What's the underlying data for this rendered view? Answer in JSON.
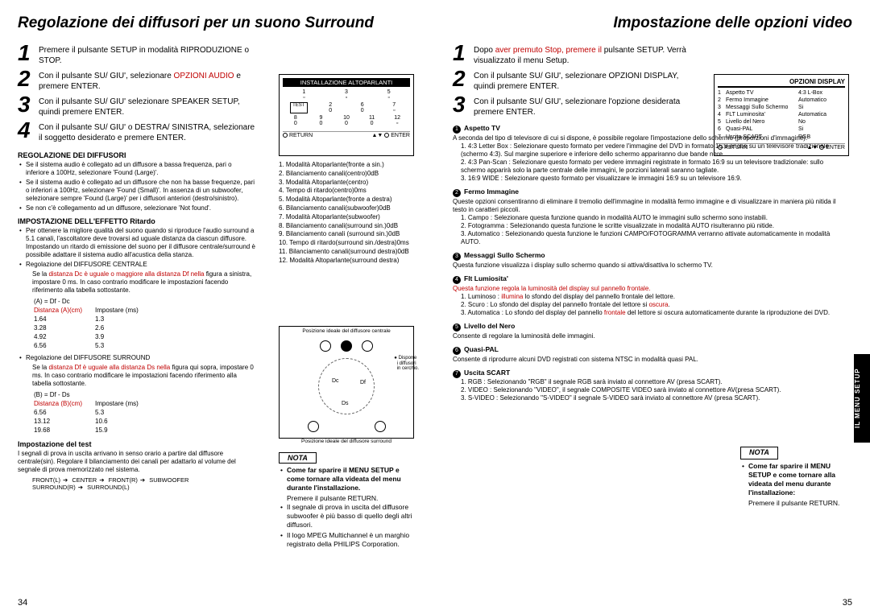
{
  "left": {
    "title": "Regolazione dei diffusori per un suono Surround",
    "steps": [
      {
        "n": "1",
        "txt": "Premere il pulsante SETUP in modalità RIPRODUZIONE o STOP."
      },
      {
        "n": "2",
        "txt_a": "Con il pulsante SU/ GIU', selezionare ",
        "red": "OPZIONI AUDIO",
        "txt_b": " e premere ENTER."
      },
      {
        "n": "3",
        "txt": "Con il pulsante SU/ GIU' selezionare SPEAKER SETUP, quindi premere ENTER."
      },
      {
        "n": "4",
        "txt": "Con il pulsante SU/ GIU' o DESTRA/ SINISTRA, selezionare il soggetto desiderato e premere ENTER."
      }
    ],
    "reg_h": "REGOLAZIONE DEI DIFFUSORI",
    "reg_b": [
      "Se il sistema audio è collegato ad un diffusore a bassa frequenza, pari o inferiore a 100Hz, selezionare 'Found (Large)'.",
      "Se il sistema audio è collegato ad un diffusore che non ha basse frequenze, pari o inferiori a 100Hz, selezionare 'Found (Small)'. In assenza di un subwoofer, selezionare sempre 'Found (Large)' per i diffusori anteriori (destro/sinistro).",
      "Se non c'è collegamento ad un diffusore, selezionare 'Not found'."
    ],
    "eff_h": "IMPOSTAZIONE DELL'EFFETTO Ritardo",
    "eff_b": "Per ottenere la migliore qualità del suono quando si riproduce l'audio surround a 5.1 canali, l'ascoltatore deve trovarsi ad uguale distanza da ciascun diffusore. Impostando un ritardo di emissione del suono per il diffusore centrale/surround è possibile adattare il sistema audio all'acustica della stanza.",
    "cen_h": "Regolazione del DIFFUSORE CENTRALE",
    "cen_red": "distanza Dc è uguale o maggiore alla distanza Df nella",
    "cen_txt": "Se la [RED] figura a sinistra, impostare 0 ms. In caso contrario modificare le impostazioni facendo riferimento alla tabella sottostante.",
    "tabA_h": "(A) = Df - Dc",
    "tabA_c1": "Distanza (A)(cm)",
    "tabA_c2": "Impostare (ms)",
    "tabA": [
      [
        "1.64",
        "1.3"
      ],
      [
        "3.28",
        "2.6"
      ],
      [
        "4.92",
        "3.9"
      ],
      [
        "6.56",
        "5.3"
      ]
    ],
    "sur_h": "Regolazione del DIFFUSORE SURROUND",
    "sur_red": "distanza Df è uguale alla distanza Ds nella",
    "sur_txt": "Se la [RED] figura qui sopra, impostare 0 ms. In caso contrario modificare le impostazioni facendo riferimento alla tabella sottostante.",
    "tabB_h": "(B) = Df - Ds",
    "tabB_c1": "Distanza (B)(cm)",
    "tabB_c2": "Impostare (ms)",
    "tabB": [
      [
        "6.56",
        "5.3"
      ],
      [
        "13.12",
        "10.6"
      ],
      [
        "19.68",
        "15.9"
      ]
    ],
    "test_h": "Impostazione del test",
    "test_b": "I segnali di prova in uscita arrivano in senso orario a partire dal diffusore centrale(sin). Regolare il bilanciamento dei canali per adattarlo al volume del segnale di prova memorizzato nel sistema.",
    "chain": [
      "FRONT(L)",
      "CENTER",
      "FRONT(R)",
      "SUBWOOFER",
      "SURROUND(R)",
      "SURROUND(L)"
    ],
    "panel_h": "INSTALLAZIONE ALTOPARLANTI",
    "panel_ret": "RETURN",
    "panel_ent": "ENTER",
    "panel_test": "TEST",
    "modes": [
      "1. Modalità Altoparlante(fronte a sin.)",
      "2. Bilanciamento canali(centro)0dB",
      "3. Modalità Altoparlante(centro)",
      "4. Tempo di ritardo(centro)0ms",
      "5. Modalità Altoparlante(fronte a destra)",
      "6. Bilanciamento canali(subwoofer)0dB",
      "7. Modalità Altoparlante(subwoofer)",
      "8. Bilanciamento canali(surround sin.)0dB",
      "9. Bilanciamento canali (surround sin.)0dB",
      "10. Tempo di ritardo(surround sin./destra)0ms",
      "11. Bilanciamento canali(surround destra)0dB",
      "12. Modalità Altoparlante(surround destra)"
    ],
    "diag_top": "Posizione ideale del diffusore centrale",
    "diag_bot": "Posizione ideale del diffusore surround",
    "diag_leg1": "Disporre",
    "diag_leg2": "i diffusori",
    "diag_leg3": "in cerchio.",
    "nota": "NOTA",
    "note1": "Come far sparire il MENU SETUP e come tornare alla videata del menu durante l'installazione.",
    "note2": "Premere il pulsante RETURN.",
    "note3": "Il segnale di prova in uscita del diffusore subwoofer è più basso di quello degli altri diffusori.",
    "note4": "Il logo MPEG Multichannel è un marghio registrato della PHILIPS Corporation.",
    "pageno": "34"
  },
  "right": {
    "title": "Impostazione delle opzioni video",
    "steps": [
      {
        "n": "1",
        "txt_a": "Dopo ",
        "red": "aver premuto Stop, premere il",
        "txt_b": " pulsante SETUP. Verrà visualizzato il menu Setup."
      },
      {
        "n": "2",
        "txt": "Con il pulsante SU/ GIU', selezionare OPZIONI DISPLAY, quindi premere ENTER."
      },
      {
        "n": "3",
        "txt": "Con il pulsante SU/ GIU', selezionare l'opzione desiderata premere ENTER."
      }
    ],
    "panel_h": "OPZIONI DISPLAY",
    "panel_items": [
      [
        "1",
        "Aspetto TV",
        "4:3 L-Box"
      ],
      [
        "2",
        "Fermo Immagine",
        "Automatico"
      ],
      [
        "3",
        "Messaggi Sullo Schermo",
        "Si"
      ],
      [
        "4",
        "FLT Luminosita'",
        "Automatica"
      ],
      [
        "5",
        "Livello del Nero",
        "No"
      ],
      [
        "6",
        "Quasi-PAL",
        "Si"
      ],
      [
        "7",
        "Uscita SCART",
        "RGB"
      ]
    ],
    "panel_ret": "RETURN",
    "panel_ent": "ENTER",
    "items": [
      {
        "n": "1",
        "h": "Aspetto TV",
        "d": "A seconda del tipo di televisore di cui si dispone, è possibile regolare l'impostazione dello schermo (proporzioni d'immagine).",
        "sub": [
          "1. 4:3 Letter Box : Selezionare questo formato per vedere l'immagine del DVD in formato 16:9 anche su un televisore tradizionale (schermo 4:3). Sul margine superiore e inferiore dello schermo appariranno due bande nere.",
          "2. 4:3 Pan-Scan : Selezionare questo formato per  vedere immagini registrate in formato 16:9 su un televisore tradizionale: sullo schermo apparirà solo la parte centrale delle immagini, le porzioni laterali saranno tagliate.",
          "3. 16:9 WIDE : Selezionare questo formato per visualizzare le immagini 16:9 su un televisore 16:9."
        ]
      },
      {
        "n": "2",
        "h": "Fermo Immagine",
        "d": "Queste opzioni consentiranno di eliminare il tremolio dell'immagine in modalità fermo immagine e di visualizzare in maniera più nitida il testo in caratteri piccoli.",
        "sub": [
          "1. Campo : Selezionare questa funzione quando in modalità AUTO le immagini sullo schermo sono instabili.",
          "2. Fotogramma : Selezionando questa funzione le scritte visualizzate in modalità AUTO risulteranno più nitide.",
          "3. Automatico : Selezionando questa funzione le funzioni CAMPO/FOTOGRAMMA verranno attivate automaticamente in modalità AUTO."
        ]
      },
      {
        "n": "3",
        "h": "Messaggi Sullo Schermo",
        "d": "Questa funzione visualizza i display sullo schermo quando si attiva/disattiva lo schermo TV."
      },
      {
        "n": "4",
        "h": "Flt Lumiosita'",
        "red": "Questa funzione regola la luminosità del display sul pannello frontale.",
        "sub": [
          "1. Luminoso : [R]illumina[/R] lo sfondo del display del pannello frontale del lettore.",
          "2. Scuro : Lo sfondo del display del pannello frontale del lettore si [R]oscura[/R].",
          "3. Automatica : Lo sfondo del display del pannello [R]frontale[/R] del lettore si oscura automaticamente durante la riproduzione dei DVD."
        ]
      },
      {
        "n": "5",
        "h": "Livello del Nero",
        "d": "Consente di regolare la luminosità delle immagini."
      },
      {
        "n": "6",
        "h": "Quasi-PAL",
        "d": "Consente di riprodurre alcuni DVD registrati con sistema NTSC in modalità quasi PAL."
      },
      {
        "n": "7",
        "h": "Uscita SCART",
        "sub": [
          "1. RGB : Selezionando \"RGB\" il segnale RGB sarà inviato al connettore AV (presa SCART).",
          "2. VIDEO : Selezionando \"VIDEO\", il segnale COMPOSITE VIDEO sarà inviato al connettore AV(presa SCART).",
          "3. S-VIDEO : Selezionando \"S-VIDEO\" il segnale S-VIDEO sarà inviato al connettore AV (presa SCART)."
        ]
      }
    ],
    "nota": "NOTA",
    "note1": "Come far sparire il MENU SETUP e come tornare alla videata del menu durante l'installazione:",
    "note2": "Premere il pulsante RETURN.",
    "sidetab": "IL MENU SETUP",
    "pageno": "35"
  }
}
